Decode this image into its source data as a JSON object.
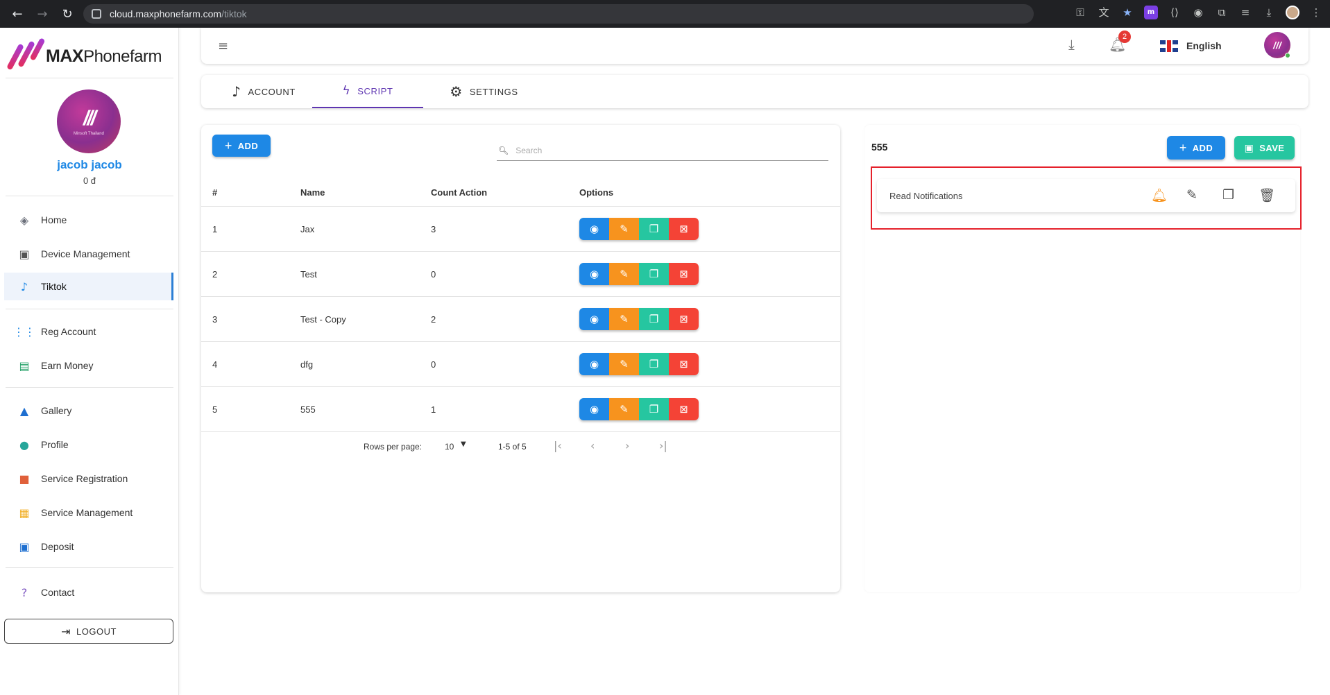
{
  "browser": {
    "host": "cloud.maxphonefarm.com",
    "path": "/tiktok",
    "nav": {
      "back": "←",
      "forward": "→",
      "reload": "↻"
    },
    "extension_icons": [
      "key-icon",
      "translate-icon",
      "star-icon",
      "maxphonefarm-ext-icon",
      "devtools-ext-icon",
      "chat-ext-icon",
      "puzzle-icon",
      "media-icon",
      "download-icon",
      "profile-icon",
      "more-icon"
    ]
  },
  "sidebar": {
    "brand_bold": "MAX",
    "brand_light": "Phonefarm",
    "avatar_caption": "Minsoft Thailand",
    "user_name": "jacob jacob",
    "balance": "0 đ",
    "items": [
      {
        "label": "Home",
        "icon": "layers-icon",
        "active": false
      },
      {
        "label": "Device Management",
        "icon": "device-icon",
        "active": false
      },
      {
        "label": "Tiktok",
        "icon": "tiktok-icon",
        "active": true
      },
      {
        "label": "Reg Account",
        "icon": "grid-icon",
        "active": false
      },
      {
        "label": "Earn Money",
        "icon": "money-icon",
        "active": false
      },
      {
        "label": "Gallery",
        "icon": "image-icon",
        "active": false
      },
      {
        "label": "Profile",
        "icon": "person-icon",
        "active": false
      },
      {
        "label": "Service Registration",
        "icon": "widgets-icon",
        "active": false
      },
      {
        "label": "Service Management",
        "icon": "service-icon",
        "active": false
      },
      {
        "label": "Deposit",
        "icon": "wallet-icon",
        "active": false
      },
      {
        "label": "Contact",
        "icon": "help-icon",
        "active": false
      }
    ],
    "logout_label": "LOGOUT"
  },
  "topbar": {
    "notification_count": "2",
    "language": "English"
  },
  "tabs": [
    {
      "label": "ACCOUNT",
      "icon": "tiktok-icon",
      "active": false
    },
    {
      "label": "SCRIPT",
      "icon": "bolt-icon",
      "active": true
    },
    {
      "label": "SETTINGS",
      "icon": "gear-icon",
      "active": false
    }
  ],
  "scripts_panel": {
    "add_label": "ADD",
    "search_placeholder": "Search",
    "columns": [
      "#",
      "Name",
      "Count Action",
      "Options"
    ],
    "rows": [
      {
        "num": "1",
        "name": "Jax",
        "count": "3"
      },
      {
        "num": "2",
        "name": "Test",
        "count": "0"
      },
      {
        "num": "3",
        "name": "Test - Copy",
        "count": "2"
      },
      {
        "num": "4",
        "name": "dfg",
        "count": "0"
      },
      {
        "num": "5",
        "name": "555",
        "count": "1"
      }
    ],
    "rows_per_page_label": "Rows per page:",
    "rows_per_page_value": "10",
    "range_text": "1-5 of 5"
  },
  "detail_panel": {
    "title": "555",
    "add_label": "ADD",
    "save_label": "SAVE",
    "actions": [
      {
        "name": "Read Notifications"
      }
    ]
  },
  "colors": {
    "primary": "#1e88e5",
    "accent_tab": "#5e35b1",
    "edit": "#f7931e",
    "copy": "#26c6a0",
    "delete": "#f44336",
    "highlight": "#e5212b"
  }
}
